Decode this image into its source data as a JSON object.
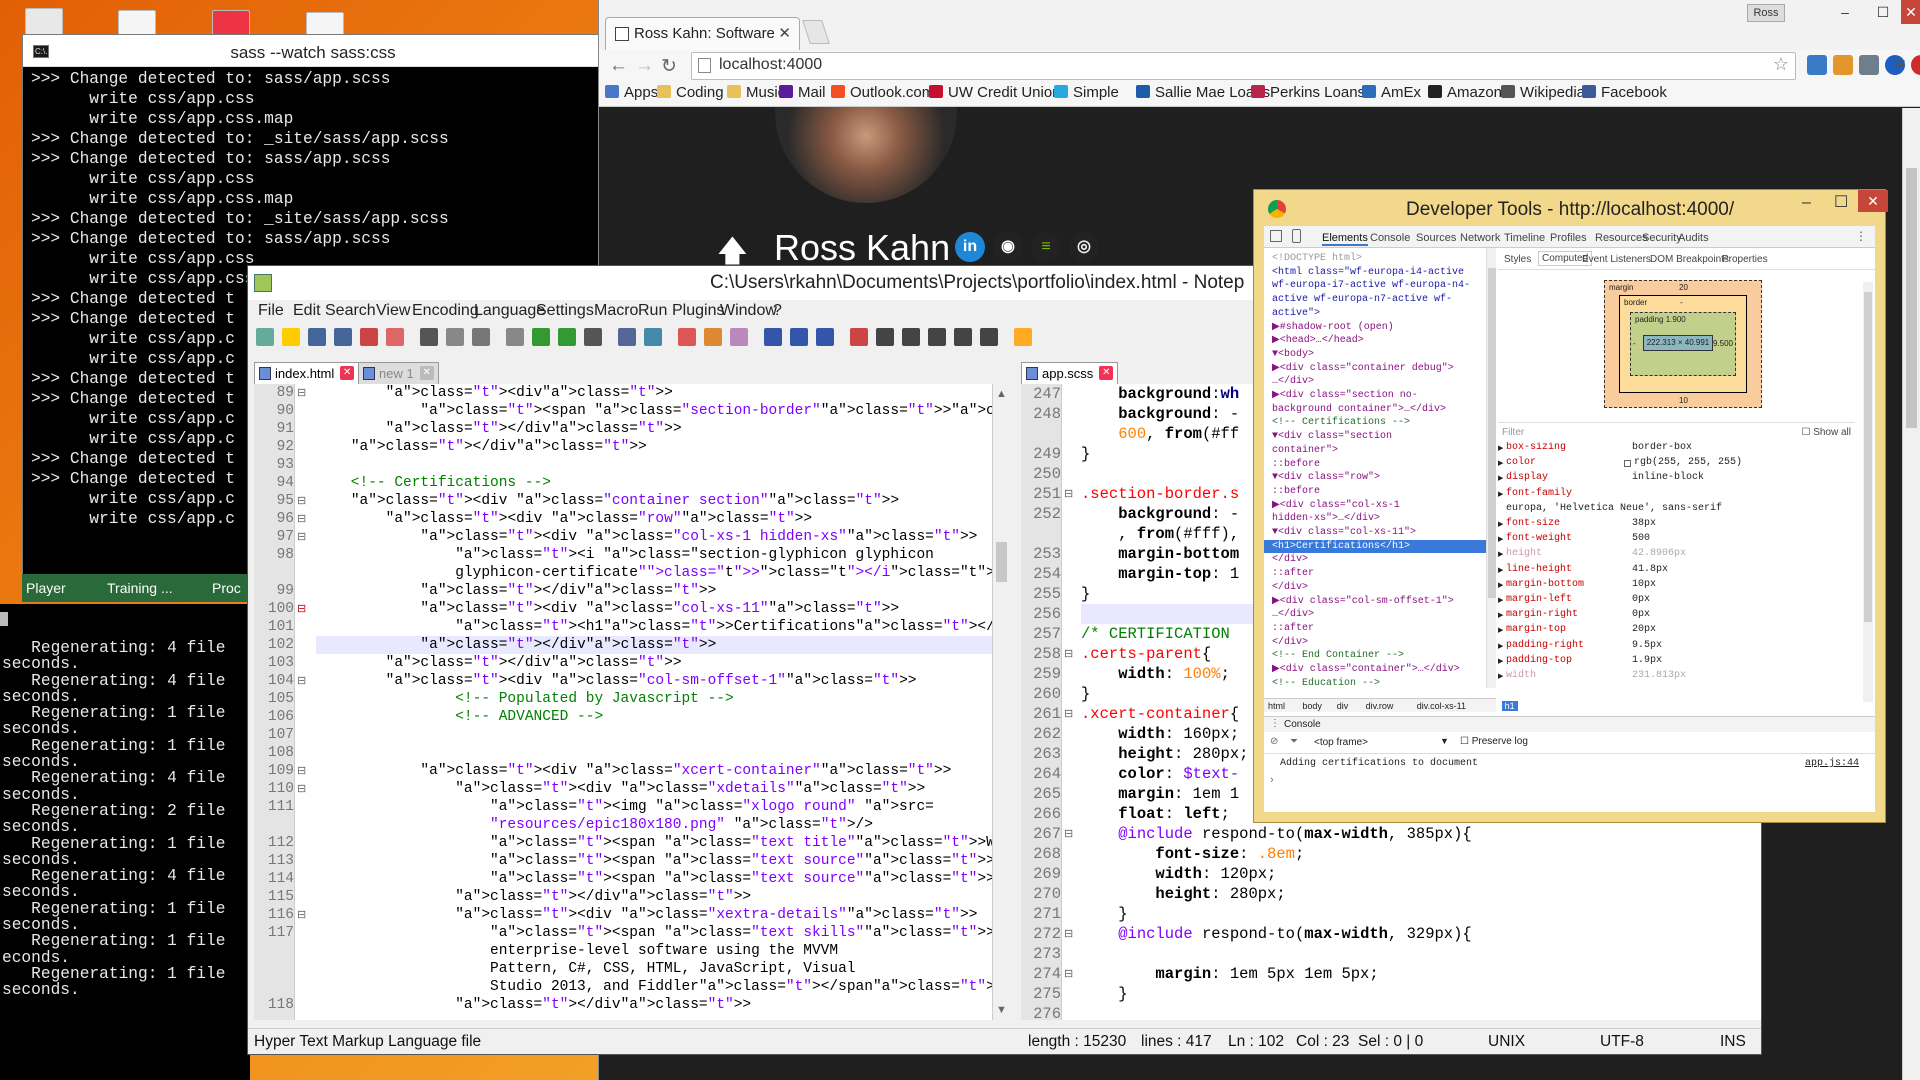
{
  "sass_window": {
    "title": "sass  --watch sass:css",
    "icon_label": "C:\\.",
    "lines": [
      ">>> Change detected to: sass/app.scss",
      "      write css/app.css",
      "      write css/app.css.map",
      ">>> Change detected to: _site/sass/app.scss",
      ">>> Change detected to: sass/app.scss",
      "      write css/app.css",
      "      write css/app.css.map",
      ">>> Change detected to: _site/sass/app.scss",
      ">>> Change detected to: sass/app.scss",
      "      write css/app.css",
      "      write css/app.css",
      ">>> Change detected t",
      ">>> Change detected t",
      "      write css/app.c",
      "      write css/app.c",
      ">>> Change detected t",
      ">>> Change detected t",
      "      write css/app.c",
      "      write css/app.c",
      ">>> Change detected t",
      ">>> Change detected t",
      "      write css/app.c",
      "      write css/app.c"
    ]
  },
  "regen_window": {
    "lines": [
      "   Regenerating: 4 file",
      "seconds.",
      "   Regenerating: 4 file",
      "seconds.",
      "   Regenerating: 1 file",
      "seconds.",
      "   Regenerating: 1 file",
      "seconds.",
      "   Regenerating: 4 file",
      "seconds.",
      "   Regenerating: 2 file",
      "seconds.",
      "   Regenerating: 1 file",
      "seconds.",
      "   Regenerating: 4 file",
      "seconds.",
      "   Regenerating: 1 file",
      "seconds.",
      "   Regenerating: 1 file",
      "econds.",
      "   Regenerating: 1 file",
      "seconds."
    ]
  },
  "taskbar_strip": {
    "items": [
      "Player",
      "Training ...",
      "Proc"
    ]
  },
  "chrome": {
    "tab_title": "Ross Kahn: Software",
    "user_badge": "Ross",
    "url": "localhost:4000",
    "bookmarks": [
      {
        "label": "Apps",
        "color": "#4a78c8"
      },
      {
        "label": "Coding",
        "color": "#e8c15a"
      },
      {
        "label": "Music",
        "color": "#e8c15a"
      },
      {
        "label": "Mail",
        "color": "#5b1aa0"
      },
      {
        "label": "Outlook.com",
        "color": "#f25022"
      },
      {
        "label": "UW Credit Union",
        "color": "#c8102e"
      },
      {
        "label": "Simple",
        "color": "#29a8e0"
      },
      {
        "label": "Sallie Mae Loans",
        "color": "#1a5dab"
      },
      {
        "label": "Perkins Loans",
        "color": "#b8254a"
      },
      {
        "label": "AmEx",
        "color": "#2a6ebb"
      },
      {
        "label": "Amazon",
        "color": "#222222"
      },
      {
        "label": "Wikipedia",
        "color": "#555555"
      },
      {
        "label": "Facebook",
        "color": "#3b5998"
      }
    ],
    "page_name": "Ross Kahn",
    "social": [
      {
        "name": "linkedin-icon",
        "glyph": "in",
        "color": "#1e88d6"
      },
      {
        "name": "github-icon",
        "glyph": "◉",
        "color": "#ffffff"
      },
      {
        "name": "spotify-icon",
        "glyph": "≡",
        "color": "#7ab800"
      },
      {
        "name": "camera-icon",
        "glyph": "◎",
        "color": "#eeeeee"
      }
    ]
  },
  "npp": {
    "title": "C:\\Users\\rkahn\\Documents\\Projects\\portfolio\\index.html - Notep",
    "menu": [
      "File",
      "Edit",
      "Search",
      "View",
      "Encoding",
      "Language",
      "Settings",
      "Macro",
      "Run",
      "Plugins",
      "Window",
      "?"
    ],
    "left_tabs": [
      "index.html",
      "new 1"
    ],
    "right_tab": "app.scss",
    "status": {
      "type": "Hyper Text Markup Language file",
      "length": "length : 15230",
      "lines": "lines : 417",
      "ln": "Ln : 102",
      "col": "Col : 23",
      "sel": "Sel : 0 | 0",
      "eol": "UNIX",
      "enc": "UTF-8",
      "mode": "INS"
    }
  },
  "devtools": {
    "title": "Developer Tools - http://localhost:4000/",
    "tabs": [
      "Elements",
      "Console",
      "Sources",
      "Network",
      "Timeline",
      "Profiles",
      "Resources",
      "Security",
      "Audits"
    ],
    "side_tabs": [
      "Styles",
      "Computed",
      "Event Listeners",
      "DOM Breakpoints",
      "Properties"
    ],
    "elements": [
      "<!DOCTYPE html>",
      "<html class=\"wf-europa-i4-active",
      "wf-europa-i7-active wf-europa-n4-",
      "active wf-europa-n7-active wf-",
      "active\">",
      "  ▶#shadow-root (open)",
      "  ▶<head>…</head>",
      "  ▼<body>",
      "    ▶<div class=\"container debug\">",
      "    …</div>",
      "    ▶<div class=\"section no-",
      "    background container\">…</div>",
      "      <!-- Certifications -->",
      "    ▼<div class=\"section",
      "    container\">",
      "        ::before",
      "      ▼<div class=\"row\">",
      "          ::before",
      "        ▶<div class=\"col-xs-1",
      "        hidden-xs\">…</div>",
      "        ▼<div class=\"col-xs-11\">",
      "            <h1>Certifications</h1>",
      "          </div>",
      "          ::after",
      "        </div>",
      "      ▶<div class=\"col-sm-offset-1\">",
      "      …</div>",
      "        ::after",
      "      </div>",
      "      <!-- End Container -->",
      "    ▶<div class=\"container\">…</div>",
      "      <!-- Education -->"
    ],
    "breadcrumb": [
      "html",
      "body",
      "div",
      "div.row",
      "div.col-xs-11",
      "h1"
    ],
    "box_model": {
      "margin": "margin",
      "margin_top": "20",
      "margin_bottom": "10",
      "margin_side": "-",
      "border": "border",
      "border_val": "-",
      "padding": "padding 1.900",
      "padding_left": "-",
      "padding_right": "9.500",
      "content": "222.313 × 40.991"
    },
    "filter_label": "Filter",
    "show_all": "Show all",
    "props": [
      [
        "box-sizing",
        "border-box"
      ],
      [
        "color",
        "rgb(255, 255, 255)"
      ],
      [
        "display",
        "inline-block"
      ],
      [
        "font-family",
        ""
      ],
      [
        "",
        "europa, 'Helvetica Neue', sans-serif"
      ],
      [
        "font-size",
        "38px"
      ],
      [
        "font-weight",
        "500"
      ],
      [
        "height",
        "42.8906px"
      ],
      [
        "line-height",
        "41.8px"
      ],
      [
        "margin-bottom",
        "10px"
      ],
      [
        "margin-left",
        "0px"
      ],
      [
        "margin-right",
        "0px"
      ],
      [
        "margin-top",
        "20px"
      ],
      [
        "padding-right",
        "9.5px"
      ],
      [
        "padding-top",
        "1.9px"
      ],
      [
        "width",
        "231.813px"
      ]
    ],
    "console_tab": "Console",
    "frame": "<top frame>",
    "preserve_log": "Preserve log",
    "console_msg": "Adding certifications to document",
    "console_src": "app.js:44"
  }
}
